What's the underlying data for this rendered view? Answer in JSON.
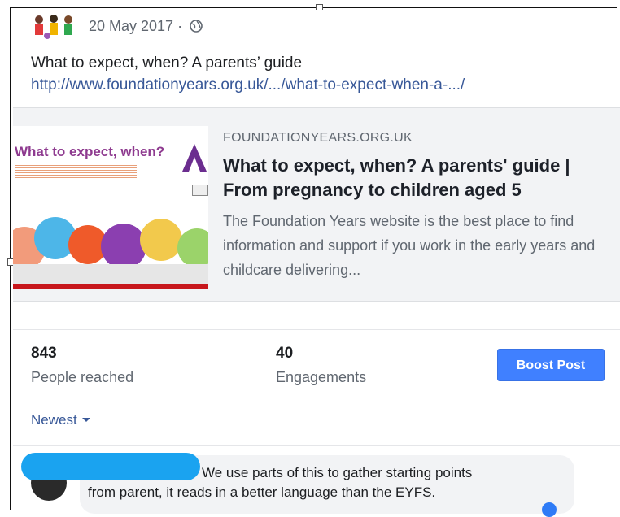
{
  "post": {
    "date": "20 May 2017 ·",
    "text": "What to expect, when? A parents’ guide",
    "link": "http://www.foundationyears.org.uk/.../what-to-expect-when-a-.../"
  },
  "card": {
    "thumb_title": "What to expect, when?",
    "domain": "FOUNDATIONYEARS.ORG.UK",
    "title": "What to expect, when? A parents' guide | From pregnancy to children aged 5",
    "description": "The Foundation Years website is the best place to find information and support if you work in the early years and childcare delivering..."
  },
  "stats": {
    "reached_value": "843",
    "reached_label": "People reached",
    "engagements_value": "40",
    "engagements_label": "Engagements",
    "boost_label": "Boost Post"
  },
  "comments": {
    "sort_label": "Newest",
    "comment_line1": "We use parts of this to gather starting points",
    "comment_line2": "from parent, it reads in a better language than the EYFS."
  },
  "colors": {
    "link": "#385898",
    "boost": "#4080ff",
    "redaction": "#1aa3f0"
  }
}
